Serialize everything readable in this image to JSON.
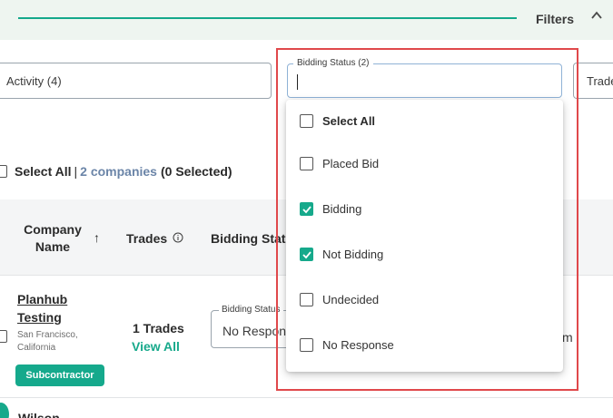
{
  "header": {
    "filters_label": "Filters",
    "toggle_icon": "chevron-up-icon"
  },
  "filters": {
    "activity_label": "Activity (4)",
    "bidding_status_label": "Bidding Status (2)",
    "trades_label": "Trade"
  },
  "selection": {
    "select_all_label": "Select All",
    "separator": "|",
    "companies_link": "2 companies",
    "selected_count": "(0 Selected)"
  },
  "table": {
    "columns": {
      "company_name": "Company Name",
      "sort_icon": "arrow-up-icon",
      "trades": "Trades",
      "trades_info_icon": "info-icon",
      "bidding_status": "Bidding Status"
    },
    "rows": [
      {
        "company_name": "Planhub Testing",
        "location": "San Francisco, California",
        "badge": "Subcontractor",
        "trades_count": "1 Trades",
        "view_all": "View All",
        "bidding_status_legend": "Bidding Status",
        "bidding_status_value": "No Response",
        "trailing_text": "m"
      },
      {
        "company_name": "Wilson"
      }
    ]
  },
  "dropdown": {
    "options": [
      {
        "label": "Select All",
        "checked": false
      },
      {
        "label": "Placed Bid",
        "checked": false
      },
      {
        "label": "Bidding",
        "checked": true
      },
      {
        "label": "Not Bidding",
        "checked": true
      },
      {
        "label": "Undecided",
        "checked": false
      },
      {
        "label": "No Response",
        "checked": false
      }
    ]
  },
  "colors": {
    "accent": "#16a98b",
    "highlight_border": "#e0484b",
    "link": "#6b85a8"
  }
}
